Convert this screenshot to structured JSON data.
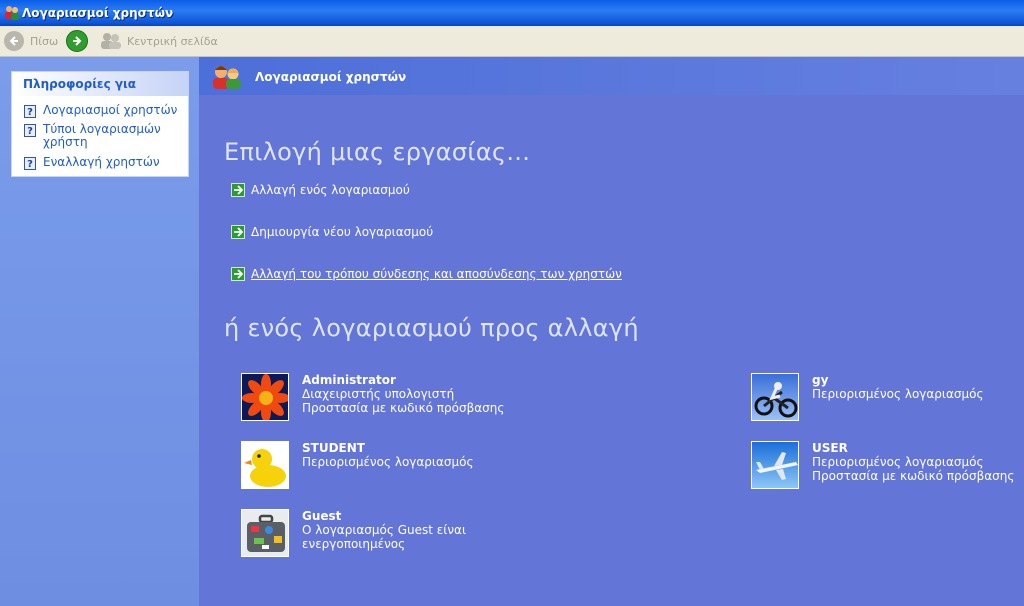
{
  "window": {
    "title": "Λογαριασμοί χρηστών"
  },
  "toolbar": {
    "back_label": "Πίσω",
    "home_label": "Κεντρική σελίδα"
  },
  "sidebar": {
    "header": "Πληροφορίες για",
    "links": [
      {
        "label": "Λογαριασμοί χρηστών"
      },
      {
        "label": "Τύποι λογαριασμών χρήστη"
      },
      {
        "label": "Εναλλαγή χρηστών"
      }
    ]
  },
  "main": {
    "header": "Λογαριασμοί χρηστών",
    "pick_task_heading": "Επιλογή μιας εργασίας...",
    "tasks": [
      {
        "label": "Αλλαγή ενός λογαριασμού"
      },
      {
        "label": "Δημιουργία νέου λογαριασμού"
      },
      {
        "label": "Αλλαγή του τρόπου σύνδεσης και αποσύνδεσης των χρηστών"
      }
    ],
    "pick_account_heading": "ή ενός λογαριασμού προς αλλαγή",
    "accounts": [
      {
        "name": "Administrator",
        "line1": "Διαχειριστής υπολογιστή",
        "line2": "Προστασία με κωδικό πρόσβασης",
        "picture": "flower"
      },
      {
        "name": "STUDENT",
        "line1": "Περιορισμένος λογαριασμός",
        "line2": "",
        "picture": "rubber-duck"
      },
      {
        "name": "Guest",
        "line1": "Ο λογαριασμός Guest είναι ενεργοποιημένος",
        "line2": "",
        "picture": "suitcase"
      },
      {
        "name": "gy",
        "line1": "Περιορισμένος λογαριασμός",
        "line2": "",
        "picture": "motocross"
      },
      {
        "name": "USER",
        "line1": "Περιορισμένος λογαριασμός",
        "line2": "Προστασία με κωδικό πρόσβασης",
        "picture": "airplane"
      }
    ]
  },
  "colors": {
    "title_blue": "#0a5ee8",
    "main_bg": "#6375d6",
    "sidebar_bg": "#7a9cea",
    "link_blue": "#215dc6",
    "task_arrow_green": "#2e9a32"
  }
}
